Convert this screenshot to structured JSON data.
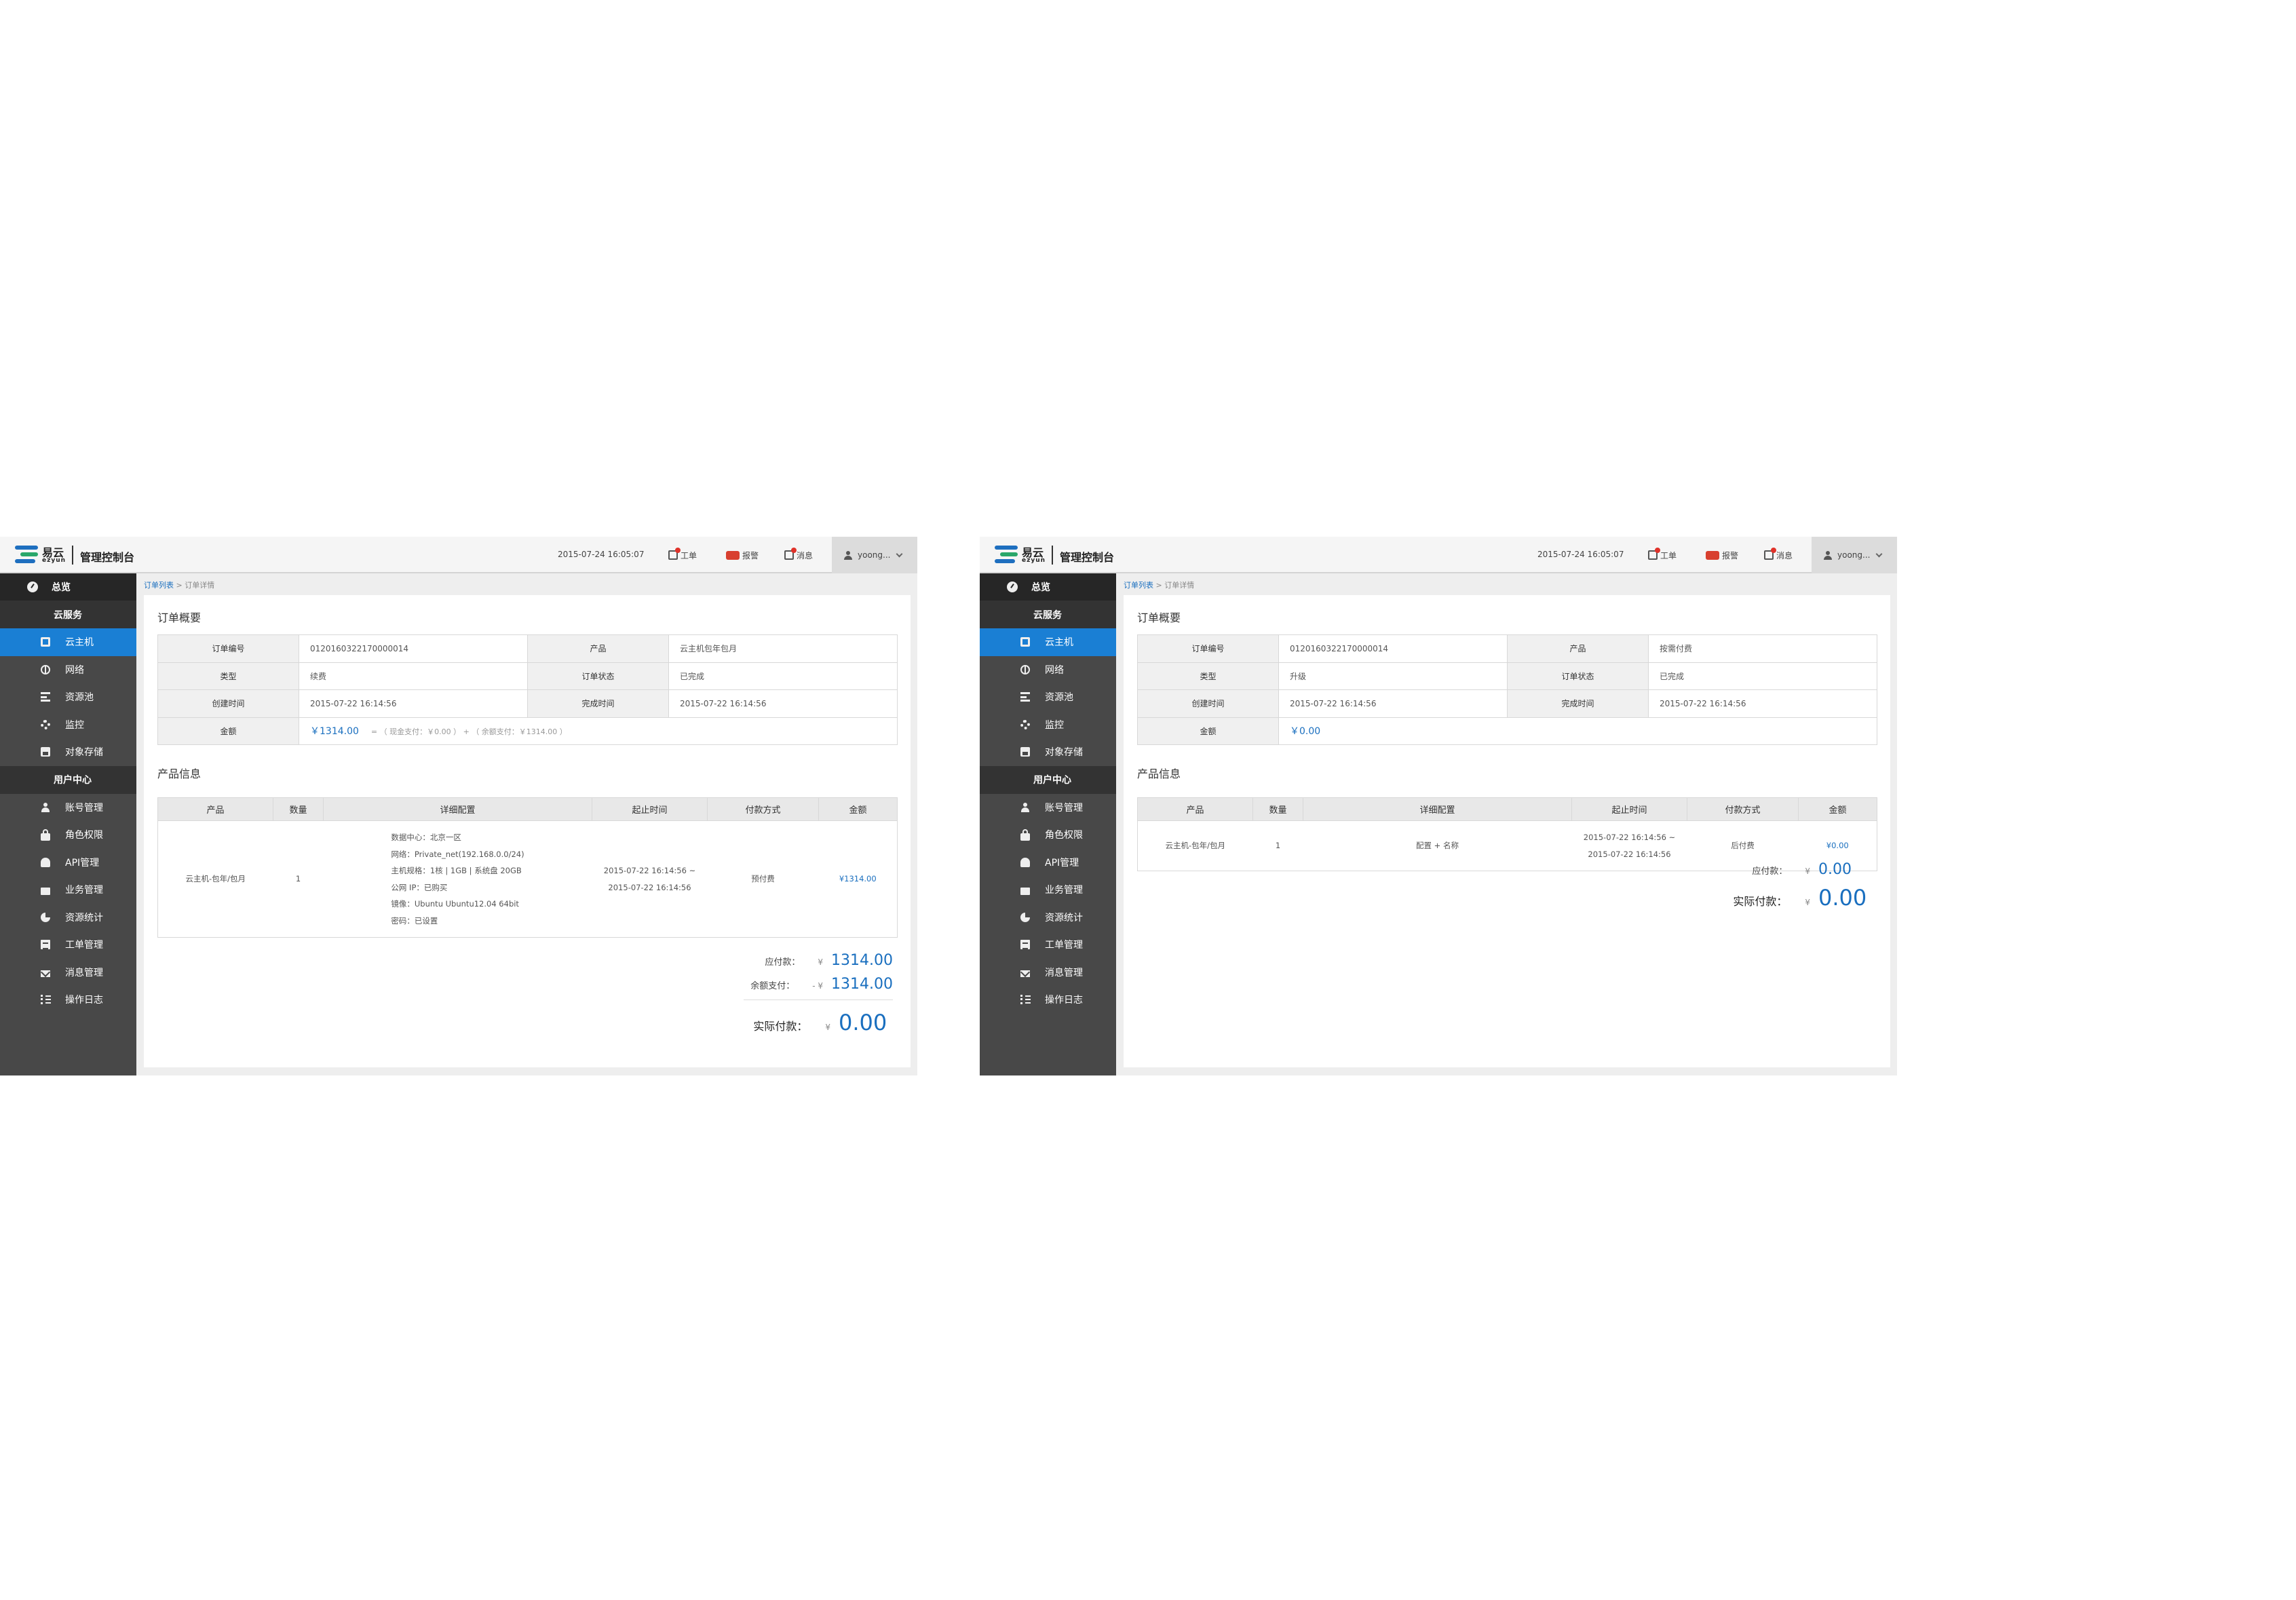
{
  "panels": [
    {
      "topbar": {
        "brand_cn": "易云",
        "brand_en": "ezyun",
        "console_title": "管理控制台",
        "datetime": "2015-07-24   16:05:07",
        "ticket_label": "工单",
        "alarm_label": "报警",
        "message_label": "消息",
        "user_label": "yoong..."
      },
      "sidebar": {
        "overview": "总览",
        "cloud_services": "云服务",
        "cloud_items": [
          "云主机",
          "网络",
          "资源池",
          "监控",
          "对象存储"
        ],
        "user_center": "用户中心",
        "user_items": [
          "账号管理",
          "角色权限",
          "API管理",
          "业务管理",
          "资源统计",
          "工单管理",
          "消息管理",
          "操作日志"
        ]
      },
      "breadcrumb": {
        "list": "订单列表",
        "sep": " > ",
        "current": "订单详情"
      },
      "summary": {
        "title": "订单概要",
        "order_no_label": "订单编号",
        "order_no": "0120160322170000014",
        "product_label": "产品",
        "product": "云主机包年包月",
        "type_label": "类型",
        "type": "续费",
        "status_label": "订单状态",
        "status": "已完成",
        "created_label": "创建时间",
        "created": "2015-07-22  16:14:56",
        "finished_label": "完成时间",
        "finished": "2015-07-22  16:14:56",
        "amount_label": "金额",
        "amount": "￥1314.00",
        "amount_note": "= （ 现金支付：￥0.00 ） + （ 余额支付：￥1314.00 ）"
      },
      "products": {
        "title": "产品信息",
        "headers": [
          "产品",
          "数量",
          "详细配置",
          "起止时间",
          "付款方式",
          "金额"
        ],
        "row": {
          "product": "云主机-包年/包月",
          "qty": "1",
          "details": [
            "数据中心：北京一区",
            "网络：Private_net(192.168.0.0/24)",
            "主机规格：1核 | 1GB | 系统盘 20GB",
            "公网 IP：已购买",
            "镜像：Ubuntu Ubuntu12.04 64bit",
            "密码：已设置"
          ],
          "period_start": "2015-07-22  16:14:56 ~",
          "period_end": "2015-07-22  16:14:56",
          "payment": "预付费",
          "amount": "¥1314.00"
        }
      },
      "totals": {
        "payable_label": "应付款：",
        "payable_cur": "¥",
        "payable": "1314.00",
        "balance_label": "余额支付：",
        "balance_cur": "- ¥",
        "balance": "1314.00",
        "actual_label": "实际付款：",
        "actual_cur": "¥",
        "actual": "0.00"
      }
    },
    {
      "topbar": {
        "brand_cn": "易云",
        "brand_en": "ezyun",
        "console_title": "管理控制台",
        "datetime": "2015-07-24   16:05:07",
        "ticket_label": "工单",
        "alarm_label": "报警",
        "message_label": "消息",
        "user_label": "yoong..."
      },
      "sidebar": {
        "overview": "总览",
        "cloud_services": "云服务",
        "cloud_items": [
          "云主机",
          "网络",
          "资源池",
          "监控",
          "对象存储"
        ],
        "user_center": "用户中心",
        "user_items": [
          "账号管理",
          "角色权限",
          "API管理",
          "业务管理",
          "资源统计",
          "工单管理",
          "消息管理",
          "操作日志"
        ]
      },
      "breadcrumb": {
        "list": "订单列表",
        "sep": " > ",
        "current": "订单详情"
      },
      "summary": {
        "title": "订单概要",
        "order_no_label": "订单编号",
        "order_no": "0120160322170000014",
        "product_label": "产品",
        "product": "按需付费",
        "type_label": "类型",
        "type": "升级",
        "status_label": "订单状态",
        "status": "已完成",
        "created_label": "创建时间",
        "created": "2015-07-22  16:14:56",
        "finished_label": "完成时间",
        "finished": "2015-07-22  16:14:56",
        "amount_label": "金额",
        "amount": "￥0.00"
      },
      "products": {
        "title": "产品信息",
        "headers": [
          "产品",
          "数量",
          "详细配置",
          "起止时间",
          "付款方式",
          "金额"
        ],
        "row": {
          "product": "云主机-包年/包月",
          "qty": "1",
          "details": [
            "配置 + 名称"
          ],
          "period_start": "2015-07-22  16:14:56 ~",
          "period_end": "2015-07-22  16:14:56",
          "payment": "后付费",
          "amount": "¥0.00"
        }
      },
      "totals": {
        "payable_label": "应付款：",
        "payable_cur": "¥",
        "payable": "0.00",
        "actual_label": "实际付款：",
        "actual_cur": "¥",
        "actual": "0.00"
      }
    }
  ],
  "colors": {
    "accent": "#1a7fd4",
    "link": "#1a6fbf",
    "sidebar": "#484848",
    "sidebar_dark": "#262626",
    "alert": "#e0322a"
  }
}
